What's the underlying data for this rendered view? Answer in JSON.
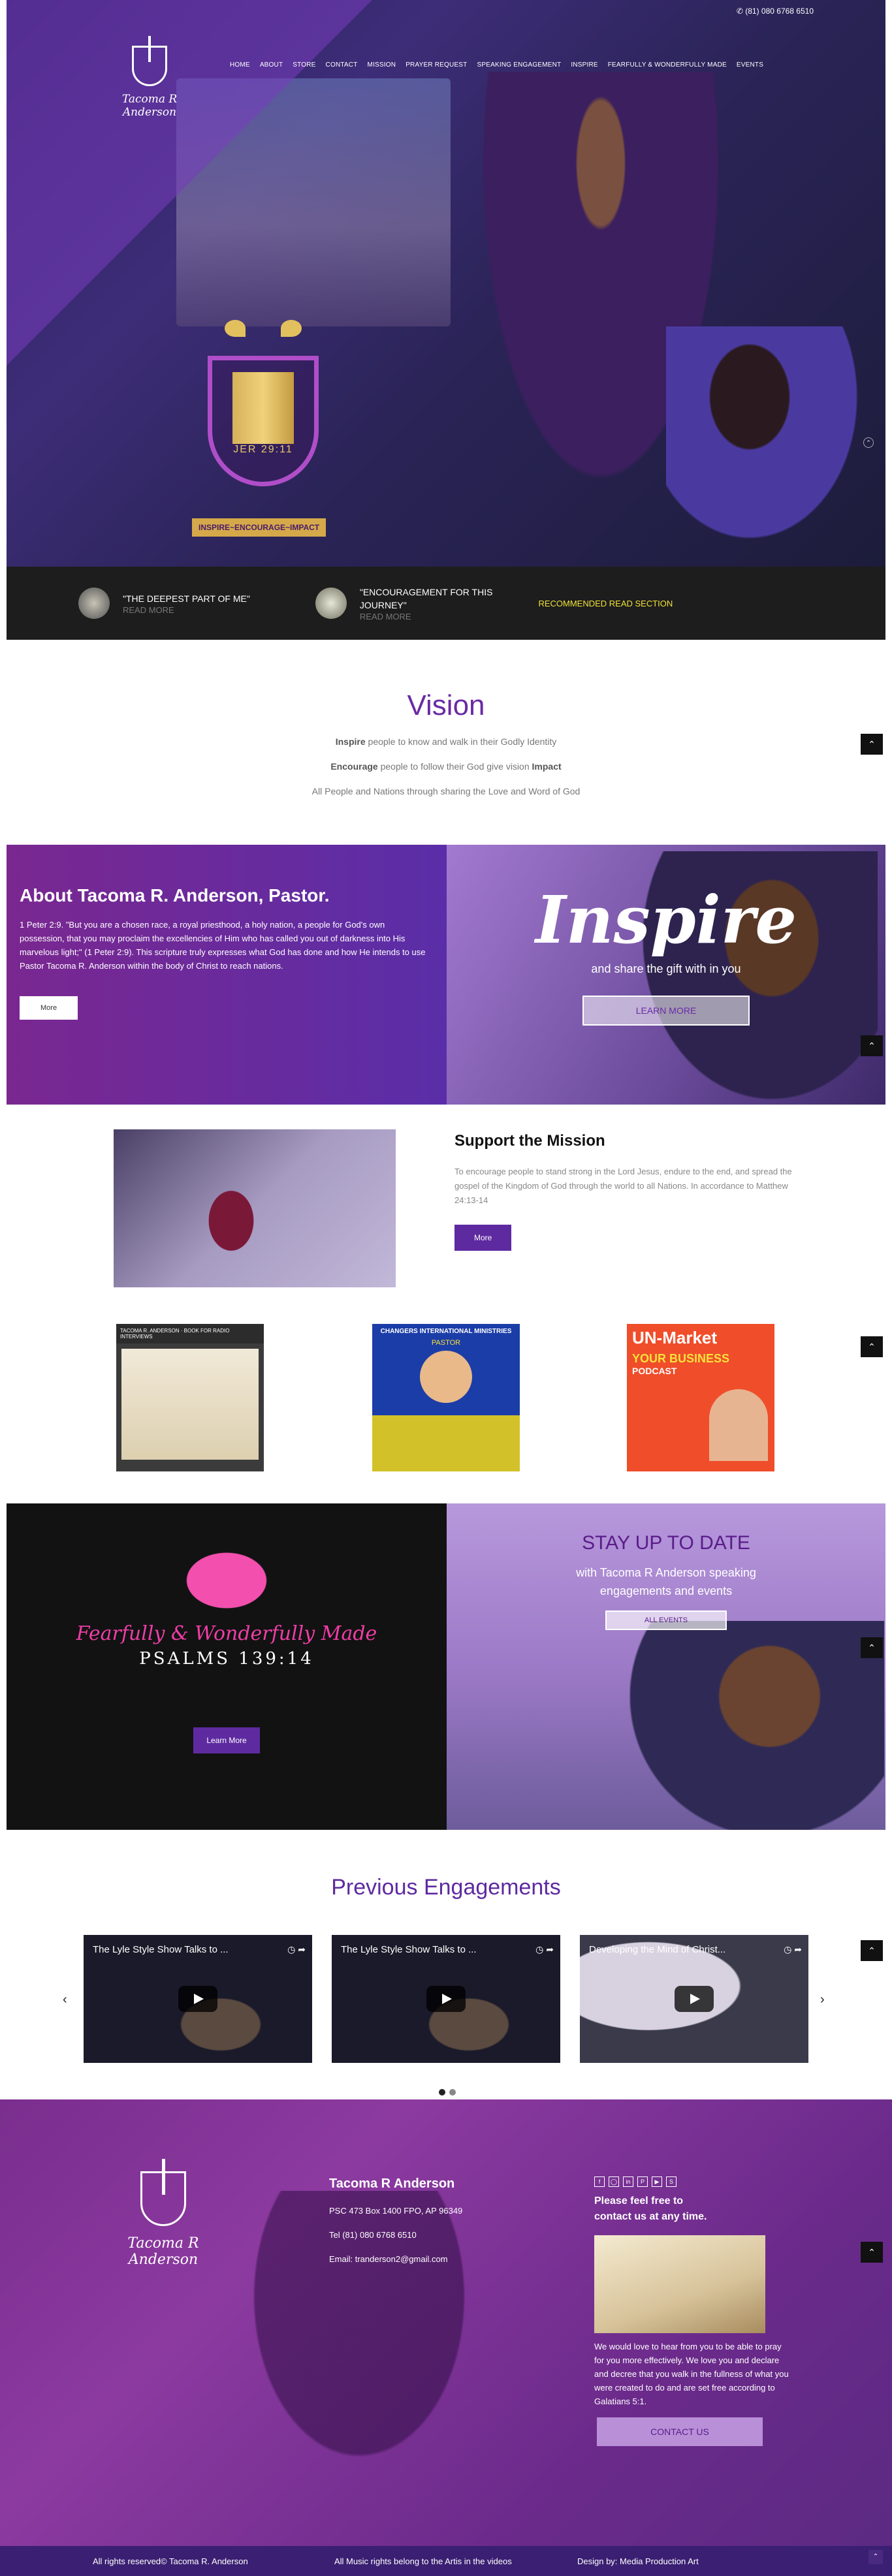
{
  "header": {
    "phone": "(81) 080 6768 6510",
    "logo_text": "Tacoma R Anderson",
    "nav": [
      "HOME",
      "ABOUT",
      "STORE",
      "CONTACT",
      "MISSION",
      "PRAYER REQUEST",
      "SPEAKING ENGAGEMENT",
      "INSPIRE",
      "FEARFULLY & WONDERFULLY MADE",
      "EVENTS"
    ]
  },
  "hero": {
    "shield_text": "JER 29:11",
    "tagline": "INSPIRE~ENCOURAGE~IMPACT"
  },
  "reads": {
    "items": [
      {
        "title": "\"THE DEEPEST PART OF ME\"",
        "more": "READ MORE"
      },
      {
        "title_line1": "\"ENCOURAGEMENT FOR THIS",
        "title_line2": "JOURNEY\"",
        "more": "READ MORE"
      }
    ],
    "section_label": "RECOMMENDED READ SECTION"
  },
  "vision": {
    "title": "Vision",
    "line1_bold": "Inspire",
    "line1_rest": " people to know and walk in their Godly Identity",
    "line2_bold": "Encourage",
    "line2_mid": " people to follow their God give vision ",
    "line2_bold2": "Impact",
    "line3": "All People and Nations through sharing the Love and Word of God"
  },
  "about": {
    "title": "About Tacoma R. Anderson, Pastor.",
    "text": "1 Peter 2:9. \"But you are a chosen race, a royal priesthood, a holy nation, a people for God's own possession, that you may proclaim the excellencies of Him who has called you out of darkness into His marvelous light;\" (1 Peter 2:9). This scripture truly expresses what God has done and how He intends to use Pastor Tacoma R. Anderson within the body of Christ to reach nations.",
    "button": "More"
  },
  "inspire": {
    "word": "Inspire",
    "sub": "and share the gift with in you",
    "button": "LEARN MORE"
  },
  "support": {
    "title": "Support the Mission",
    "text": "To encourage people to stand strong in the Lord Jesus, endure to the end, and spread the gospel of the Kingdom of God through the world to all Nations. In accordance to Matthew 24:13-14",
    "button": "More"
  },
  "flyers": {
    "f1_band": "TACOMA R. ANDERSON · BOOK FOR RADIO INTERVIEWS",
    "f2_band": "CHANGERS INTERNATIONAL MINISTRIES",
    "f2_sub": "PASTOR",
    "f3_line1": "UN-Market",
    "f3_line2": "YOUR BUSINESS",
    "f3_line3": "PODCAST"
  },
  "fearfully": {
    "line1": "Fearfully & Wonderfully Made",
    "line2": "PSALMS 139:14",
    "button": "Learn More"
  },
  "stay": {
    "title": "STAY UP TO DATE",
    "sub1": "with Tacoma R Anderson speaking",
    "sub2": "engagements and events",
    "button": "ALL EVENTS"
  },
  "previous": {
    "title": "Previous Engagements",
    "videos": [
      "The Lyle Style Show Talks to ...",
      "The Lyle Style Show Talks to ...",
      "Developing the Mind of Christ..."
    ]
  },
  "footer": {
    "logo_text": "Tacoma R Anderson",
    "name": "Tacoma R Anderson",
    "address": "PSC 473 Box 1400 FPO, AP 96349",
    "tel": "Tel (81) 080 6768 6510",
    "email": "Email: tranderson2@gmail.com",
    "contact_head1": "Please feel free to",
    "contact_head2": "contact us at any time.",
    "contact_text": "We would love to hear from you to be able to pray for you more effectively. We love you and declare and decree that you walk in the fullness of what you were created to do and are set free according to Galatians 5:1.",
    "contact_button": "CONTACT US",
    "rights": "All rights reserved© Tacoma R. Anderson",
    "music": "All Music rights belong to the Artis in the videos",
    "design": "Design by: Media Production Art"
  },
  "icons": {
    "up": "chevron-up-icon",
    "social": [
      "facebook-icon",
      "instagram-icon",
      "linkedin-icon",
      "pinterest-icon",
      "youtube-icon",
      "skype-icon"
    ]
  },
  "colors": {
    "primary": "#5e2aa0",
    "accent": "#f1e23a"
  }
}
